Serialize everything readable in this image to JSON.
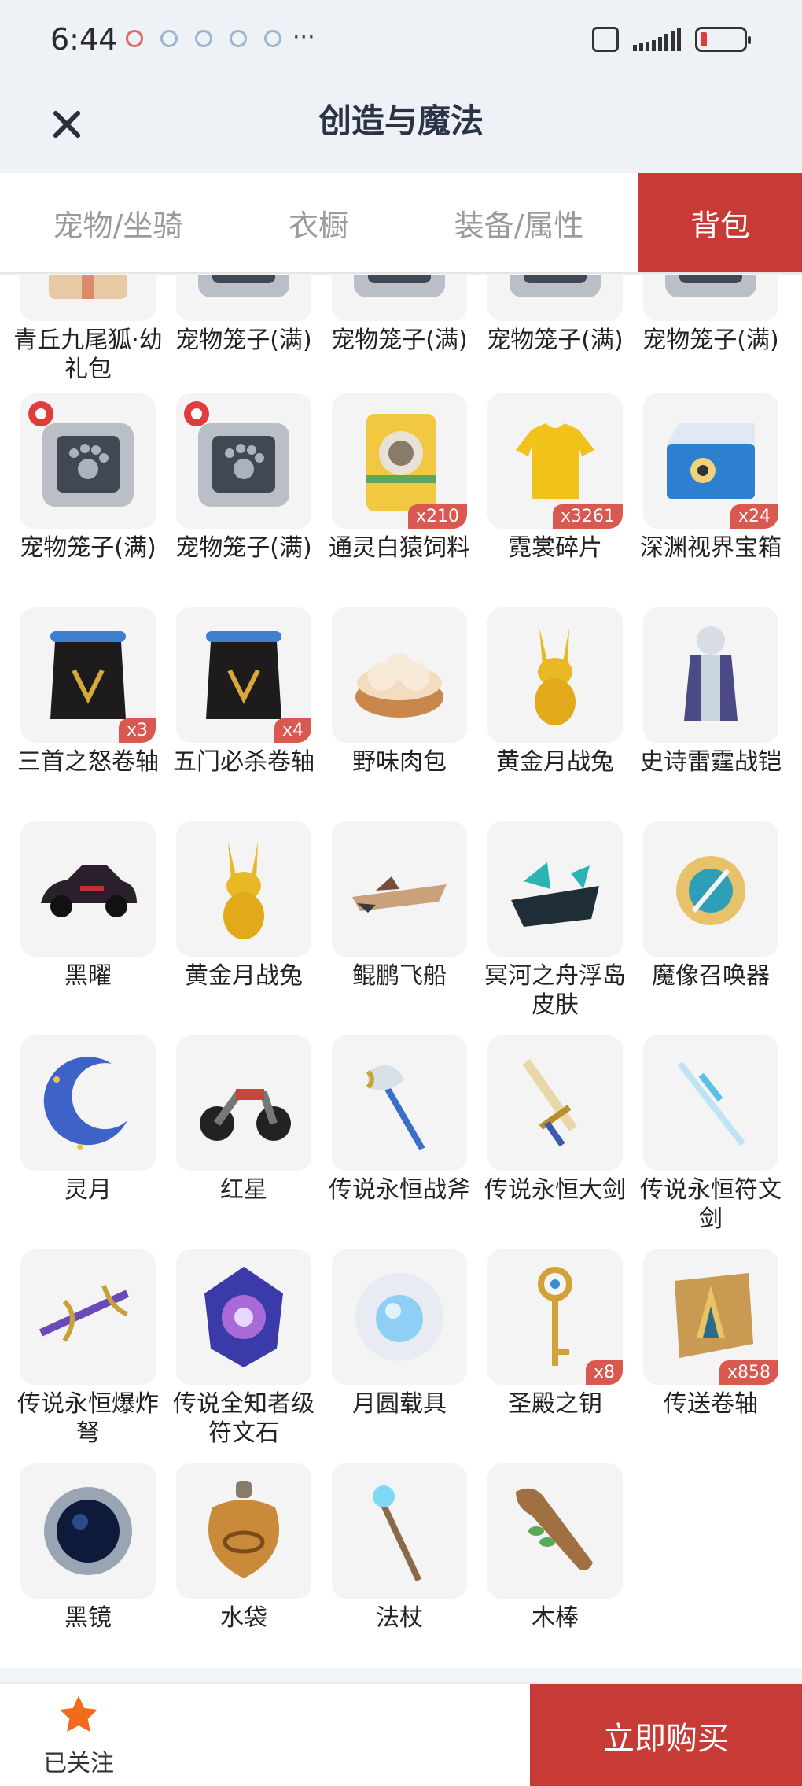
{
  "status_bar": {
    "time": "6:44",
    "more": "···"
  },
  "header": {
    "title": "创造与魔法"
  },
  "tabs": [
    {
      "label": "宠物/坐骑",
      "active": false
    },
    {
      "label": "衣橱",
      "active": false
    },
    {
      "label": "装备/属性",
      "active": false
    },
    {
      "label": "背包",
      "active": true
    }
  ],
  "items": [
    {
      "name": "青丘九尾狐·幼礼包",
      "icon": "gift-box-icon",
      "partial": true
    },
    {
      "name": "宠物笼子(满)",
      "icon": "pet-cage-icon",
      "partial": true
    },
    {
      "name": "宠物笼子(满)",
      "icon": "pet-cage-icon",
      "partial": true
    },
    {
      "name": "宠物笼子(满)",
      "icon": "pet-cage-icon",
      "partial": true
    },
    {
      "name": "宠物笼子(满)",
      "icon": "pet-cage-icon",
      "partial": true
    },
    {
      "name": "宠物笼子(满)",
      "icon": "pet-cage-icon",
      "pet": true
    },
    {
      "name": "宠物笼子(满)",
      "icon": "pet-cage-icon",
      "pet": true
    },
    {
      "name": "通灵白猿饲料",
      "icon": "feed-bag-icon",
      "count": "x210"
    },
    {
      "name": "霓裳碎片",
      "icon": "shirt-icon",
      "count": "x3261"
    },
    {
      "name": "深渊视界宝箱",
      "icon": "treasure-chest-icon",
      "count": "x24"
    },
    {
      "name": "三首之怒卷轴",
      "icon": "scroll-icon",
      "count": "x3"
    },
    {
      "name": "五门必杀卷轴",
      "icon": "scroll-icon",
      "count": "x4"
    },
    {
      "name": "野味肉包",
      "icon": "steamer-bun-icon"
    },
    {
      "name": "黄金月战兔",
      "icon": "golden-rabbit-icon"
    },
    {
      "name": "史诗雷霆战铠",
      "icon": "armor-icon"
    },
    {
      "name": "黑曜",
      "icon": "car-icon"
    },
    {
      "name": "黄金月战兔",
      "icon": "golden-rabbit-icon"
    },
    {
      "name": "鲲鹏飞船",
      "icon": "airship-icon"
    },
    {
      "name": "冥河之舟浮岛皮肤",
      "icon": "island-skin-icon"
    },
    {
      "name": "魔像召唤器",
      "icon": "summoner-icon"
    },
    {
      "name": "灵月",
      "icon": "crescent-moon-icon"
    },
    {
      "name": "红星",
      "icon": "motorcycle-icon"
    },
    {
      "name": "传说永恒战斧",
      "icon": "battle-axe-icon"
    },
    {
      "name": "传说永恒大剑",
      "icon": "greatsword-icon"
    },
    {
      "name": "传说永恒符文剑",
      "icon": "rune-sword-icon"
    },
    {
      "name": "传说永恒爆炸弩",
      "icon": "crossbow-icon"
    },
    {
      "name": "传说全知者级符文石",
      "icon": "rune-stone-icon"
    },
    {
      "name": "月圆载具",
      "icon": "moon-orb-icon"
    },
    {
      "name": "圣殿之钥",
      "icon": "key-icon",
      "count": "x8"
    },
    {
      "name": "传送卷轴",
      "icon": "teleport-scroll-icon",
      "count": "x858"
    },
    {
      "name": "黑镜",
      "icon": "dark-mirror-icon"
    },
    {
      "name": "水袋",
      "icon": "water-bag-icon"
    },
    {
      "name": "法杖",
      "icon": "staff-icon"
    },
    {
      "name": "木棒",
      "icon": "club-icon"
    }
  ],
  "bottom_bar": {
    "follow_label": "已关注",
    "buy_label": "立即购买"
  },
  "colors": {
    "accent": "#c83a35",
    "badge": "#d9584f",
    "follow_star": "#f26a1b"
  }
}
